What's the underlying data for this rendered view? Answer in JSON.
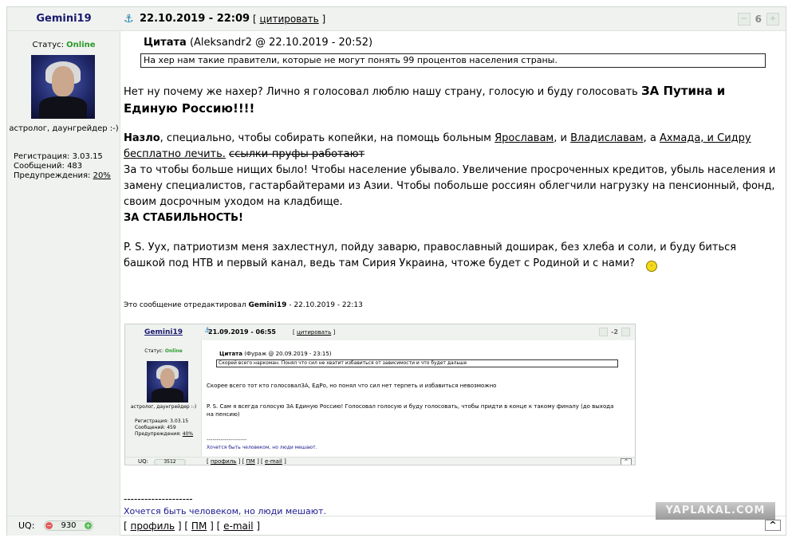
{
  "post": {
    "author": "Gemini19",
    "date": "22.10.2019 - 22:09",
    "quote_link": "цитировать",
    "rating": "6",
    "status_label": "Статус:",
    "status_value": "Online",
    "user_title": "астролог, даунгрейдер :-)",
    "stats": {
      "registration_label": "Регистрация:",
      "registration_value": "3.03.15",
      "messages_label": "Сообщений:",
      "messages_value": "483",
      "warnings_label": "Предупреждения:",
      "warnings_value": "20%"
    },
    "quote": {
      "label": "Цитата",
      "meta": "(Aleksandr2 @ 22.10.2019 - 20:52)",
      "text": "На хер нам такие правители, которые не могут понять 99 процентов населения страны."
    },
    "p1_text": "Нет ну почему же нахер? Лично я голосовал люблю нашу страну, голосую и буду голосовать ",
    "p1_bold": "ЗА Путина и Единую Россию!!!!",
    "p2": {
      "bold_start": "Назло",
      "t1": ", специально, чтобы собирать копейки, на помощь больным ",
      "link1": "Ярославам",
      "t2": ", и ",
      "link2": "Владиславам",
      "t3": ", а ",
      "link3": "Ахмада, и Сидру бесплатно лечить.",
      "strike": "ссылки-пруфы работают",
      "t4": "За то чтобы больше нищих было! Чтобы население убывало. Увеличение просроченных кредитов, убыль населения и замену специалистов, гастарбайтерами из Азии. Чтобы побольше россиян облегчили нагрузку на пенсионный, фонд, своим досрочным уходом на кладбище.",
      "bold_end": "ЗА СТАБИЛЬНОСТЬ!"
    },
    "p3": "P. S. Уух, патриотизм меня захлестнул, пойду заварю, православный доширак, без хлеба и соли, и буду биться башкой под НТВ и первый канал, ведь там Сирия Украина, чтоже будет с Родиной и с нами?",
    "edited_prefix": "Это сообщение отредактировал ",
    "edited_user": "Gemini19",
    "edited_suffix": " - 22.10.2019 - 22:13",
    "signature_sep": "--------------------",
    "signature": "Хочется быть человеком, но люди мешают.",
    "uq_label": "UQ:",
    "uq_value": "930",
    "links": {
      "profile": "профиль",
      "pm": "ПМ",
      "email": "e-mail"
    },
    "scroll_top": "^"
  },
  "embedded": {
    "author": "Gemini19",
    "date": "21.09.2019 - 06:55",
    "quote_link": "цитировать",
    "rating": "-2",
    "status_label": "Статус:",
    "status_value": "Online",
    "user_title": "астролог, даунгрейдер :-)",
    "registration": "Регистрация: 3.03.15",
    "messages": "Сообщений: 459",
    "warnings_label": "Предупреждения: ",
    "warnings_value": "40%",
    "quote_label": "Цитата",
    "quote_meta": "(Фураж @ 20.09.2019 - 23:15)",
    "quote_text": "Скорей всего наркоман. Понял что сил не хватит избавиться от зависимости и что будет дальше",
    "text1": "Скорее всего тот кто голосовалЗА, ЕдРо, но понял что сил нет терпеть и избавиться невозможно",
    "text2": "P. S. Сам я всегда голосую ЗА Единую Россию! Голосовал голосую и буду голосовать, чтобы придти в конце к такому финалу (до выхода на пенсию)",
    "sep": "--------------------",
    "signature": "Хочется быть человеком, но люди мешают.",
    "uq_label": "UQ:",
    "uq_value": "3512",
    "profile": "профиль",
    "pm": "ПМ",
    "email": "e-mail"
  },
  "watermark": "YAPLAKAL.COM",
  "icons": [
    "anchor-icon",
    "vote-down-icon",
    "vote-up-icon",
    "plus-icon",
    "minus-icon",
    "smiley-icon"
  ]
}
